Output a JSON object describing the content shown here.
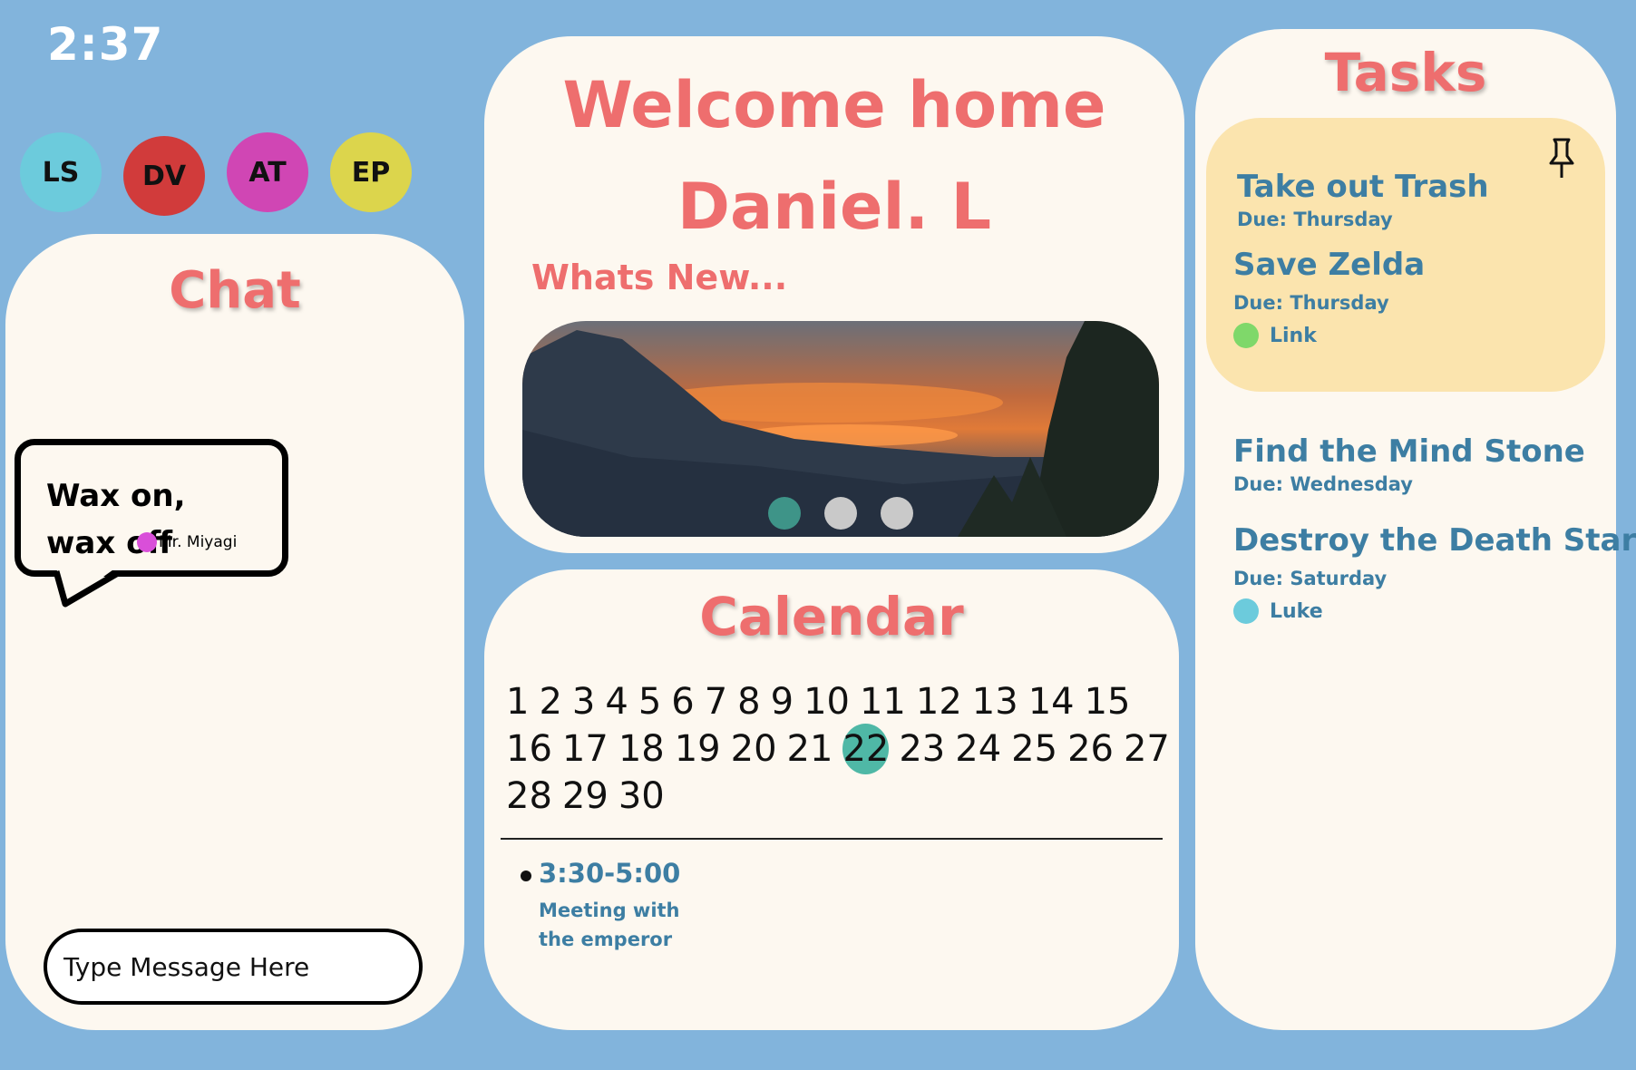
{
  "clock": "2:37",
  "users": [
    {
      "initials": "LS",
      "color": "#6ccbdc"
    },
    {
      "initials": "DV",
      "color": "#d13b3b"
    },
    {
      "initials": "AT",
      "color": "#d046b4"
    },
    {
      "initials": "EP",
      "color": "#dcd54c"
    }
  ],
  "chat": {
    "title": "Chat",
    "messages": [
      {
        "text": "Wax on, wax off",
        "author": "Mr. Miyagi",
        "author_color": "#d94fd9"
      }
    ],
    "input_placeholder": "Type Message Here"
  },
  "welcome": {
    "line1": "Welcome home",
    "line2": "Daniel. L",
    "whats_new": "Whats New...",
    "carousel": {
      "active_index": 0,
      "count": 3,
      "active_color": "#3e9488",
      "inactive_color": "#c9c9c9"
    }
  },
  "calendar": {
    "title": "Calendar",
    "rows": [
      [
        "1",
        "2",
        "3",
        "4",
        "5",
        "6",
        "7",
        "8",
        "9",
        "10",
        "11",
        "12",
        "13",
        "14",
        "15"
      ],
      [
        "16",
        "17",
        "18",
        "19",
        "20",
        "21",
        "22",
        "23",
        "24",
        "25",
        "26",
        "27"
      ],
      [
        "28",
        "29",
        "30"
      ]
    ],
    "selected_day": "22",
    "selected_color": "#4fb8a6",
    "events": [
      {
        "time": "3:30-5:00",
        "description": "Meeting with the emperor"
      }
    ]
  },
  "tasks": {
    "title": "Tasks",
    "pinned": [
      {
        "name": "Take out Trash",
        "due": "Due: Thursday"
      },
      {
        "name": "Save Zelda",
        "due": "Due: Thursday",
        "assignee": "Link",
        "assignee_color": "#7fd86a"
      }
    ],
    "other": [
      {
        "name": "Find the Mind Stone",
        "due": "Due: Wednesday"
      },
      {
        "name": "Destroy the Death Star",
        "due": "Due: Saturday",
        "assignee": "Luke",
        "assignee_color": "#6ccbdc"
      }
    ]
  },
  "colors": {
    "background": "#82b4dc",
    "panel": "#fdf8f0",
    "accent_title": "#ee6e6e",
    "task_text": "#3d7ea3",
    "pinned_card": "#fbe4ae"
  }
}
